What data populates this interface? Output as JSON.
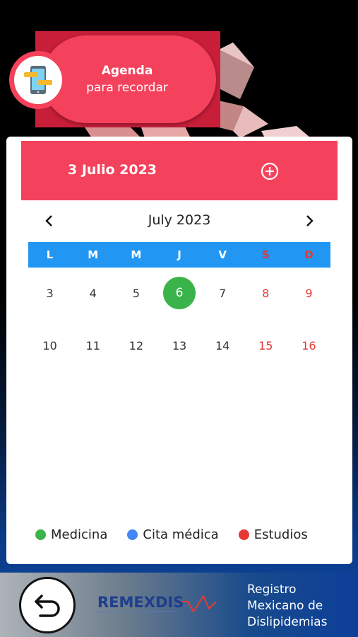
{
  "header": {
    "title": "Agenda",
    "subtitle": "para recordar"
  },
  "calendar": {
    "selected_date": "3 Julio 2023",
    "month_label": "July 2023",
    "weekdays": [
      "L",
      "M",
      "M",
      "J",
      "V",
      "S",
      "D"
    ],
    "weeks": [
      [
        "3",
        "4",
        "5",
        "6",
        "7",
        "8",
        "9"
      ],
      [
        "10",
        "11",
        "12",
        "13",
        "14",
        "15",
        "16"
      ]
    ],
    "today": "6"
  },
  "legend": [
    {
      "label": "Medicina",
      "color": "#3ab44a"
    },
    {
      "label": "Cita médica",
      "color": "#4287f5"
    },
    {
      "label": "Estudios",
      "color": "#e53935"
    }
  ],
  "footer": {
    "logo_text": "REMEXDIS",
    "registro_lines": [
      "Registro",
      "Mexicano de",
      "Dislipidemias"
    ]
  },
  "colors": {
    "accent": "#f4415c",
    "weekday_bar": "#2196f3",
    "today": "#3ab44a",
    "weekend": "#e53935"
  },
  "icons": {
    "agenda": "phone-chat-icon",
    "add": "plus-circle-icon",
    "prev": "chevron-left-icon",
    "next": "chevron-right-icon",
    "back": "undo-arrow-icon"
  }
}
